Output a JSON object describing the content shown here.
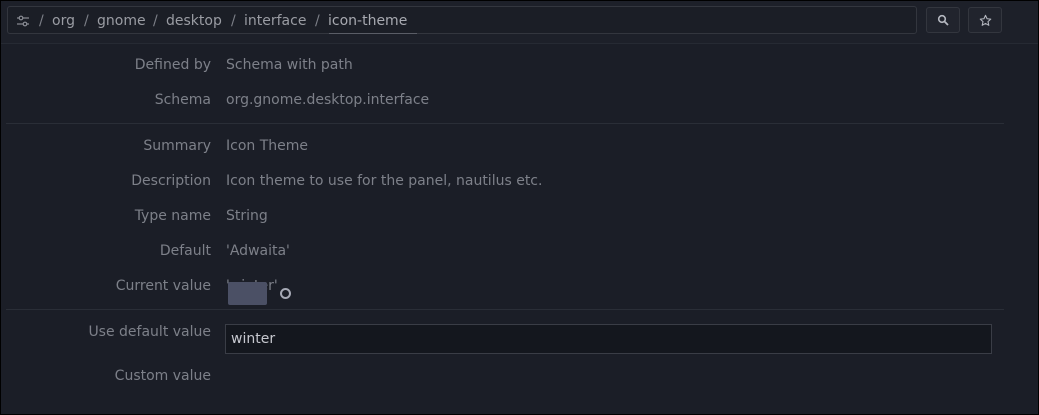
{
  "pathbar": {
    "segments": [
      "org",
      "gnome",
      "desktop",
      "interface",
      "icon-theme"
    ],
    "separator": "/"
  },
  "toolbar": {
    "search_icon": "search-icon",
    "bookmark_icon": "star-icon"
  },
  "details": {
    "defined_by_label": "Defined by",
    "defined_by_value": "Schema with path",
    "schema_label": "Schema",
    "schema_value": "org.gnome.desktop.interface",
    "summary_label": "Summary",
    "summary_value": "Icon Theme",
    "description_label": "Description",
    "description_value": "Icon theme to use for the panel, nautilus etc.",
    "type_label": "Type name",
    "type_value": "String",
    "default_label": "Default",
    "default_value": "'Adwaita'",
    "current_label": "Current value",
    "current_value": "'winter'"
  },
  "controls": {
    "use_default_label": "Use default value",
    "use_default_state": "off",
    "custom_label": "Custom value",
    "custom_value": "winter"
  },
  "colors": {
    "background": "#1b1e27",
    "switch_track": "#4b5065"
  }
}
